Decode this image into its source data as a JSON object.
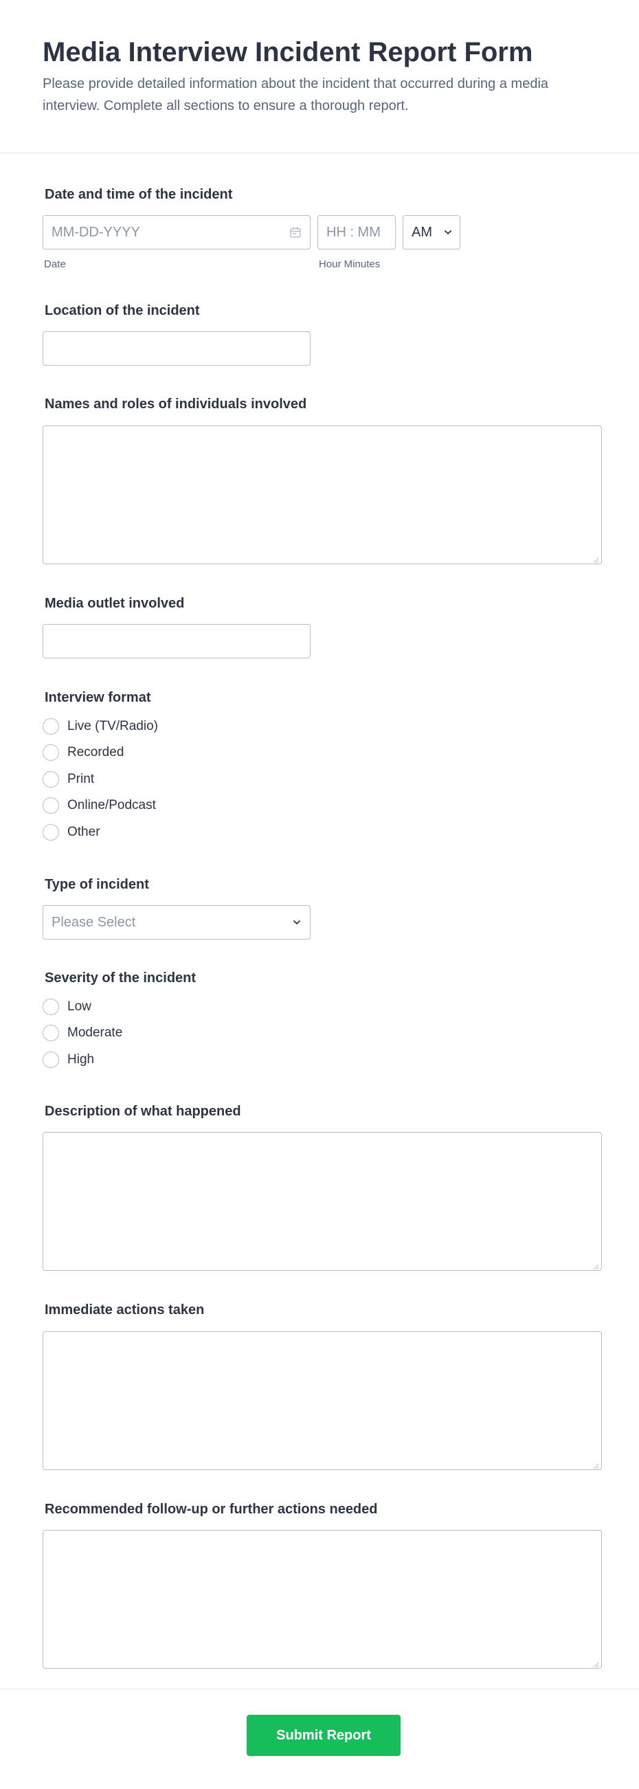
{
  "header": {
    "title": "Media Interview Incident Report Form",
    "subtitle": "Please provide detailed information about the incident that occurred during a media interview. Complete all sections to ensure a thorough report."
  },
  "datetime": {
    "label": "Date and time of the incident",
    "date_placeholder": "MM-DD-YYYY",
    "time_placeholder": "HH : MM",
    "ampm_value": "AM",
    "date_sublabel": "Date",
    "time_sublabel": "Hour Minutes",
    "calendar_icon": "calendar-icon"
  },
  "location": {
    "label": "Location of the incident",
    "value": ""
  },
  "individuals": {
    "label": "Names and roles of individuals involved",
    "value": ""
  },
  "outlet": {
    "label": "Media outlet involved",
    "value": ""
  },
  "interview_format": {
    "label": "Interview format",
    "options": [
      "Live (TV/Radio)",
      "Recorded",
      "Print",
      "Online/Podcast",
      "Other"
    ]
  },
  "incident_type": {
    "label": "Type of incident",
    "placeholder": "Please Select"
  },
  "severity": {
    "label": "Severity of the incident",
    "options": [
      "Low",
      "Moderate",
      "High"
    ]
  },
  "description": {
    "label": "Description of what happened",
    "value": ""
  },
  "actions": {
    "label": "Immediate actions taken",
    "value": ""
  },
  "followup": {
    "label": "Recommended follow-up or further actions needed",
    "value": ""
  },
  "footer": {
    "submit_label": "Submit Report"
  },
  "colors": {
    "accent": "#18bd5b",
    "text": "#2c3345",
    "muted": "#57647e",
    "border": "#b8bdc9"
  }
}
